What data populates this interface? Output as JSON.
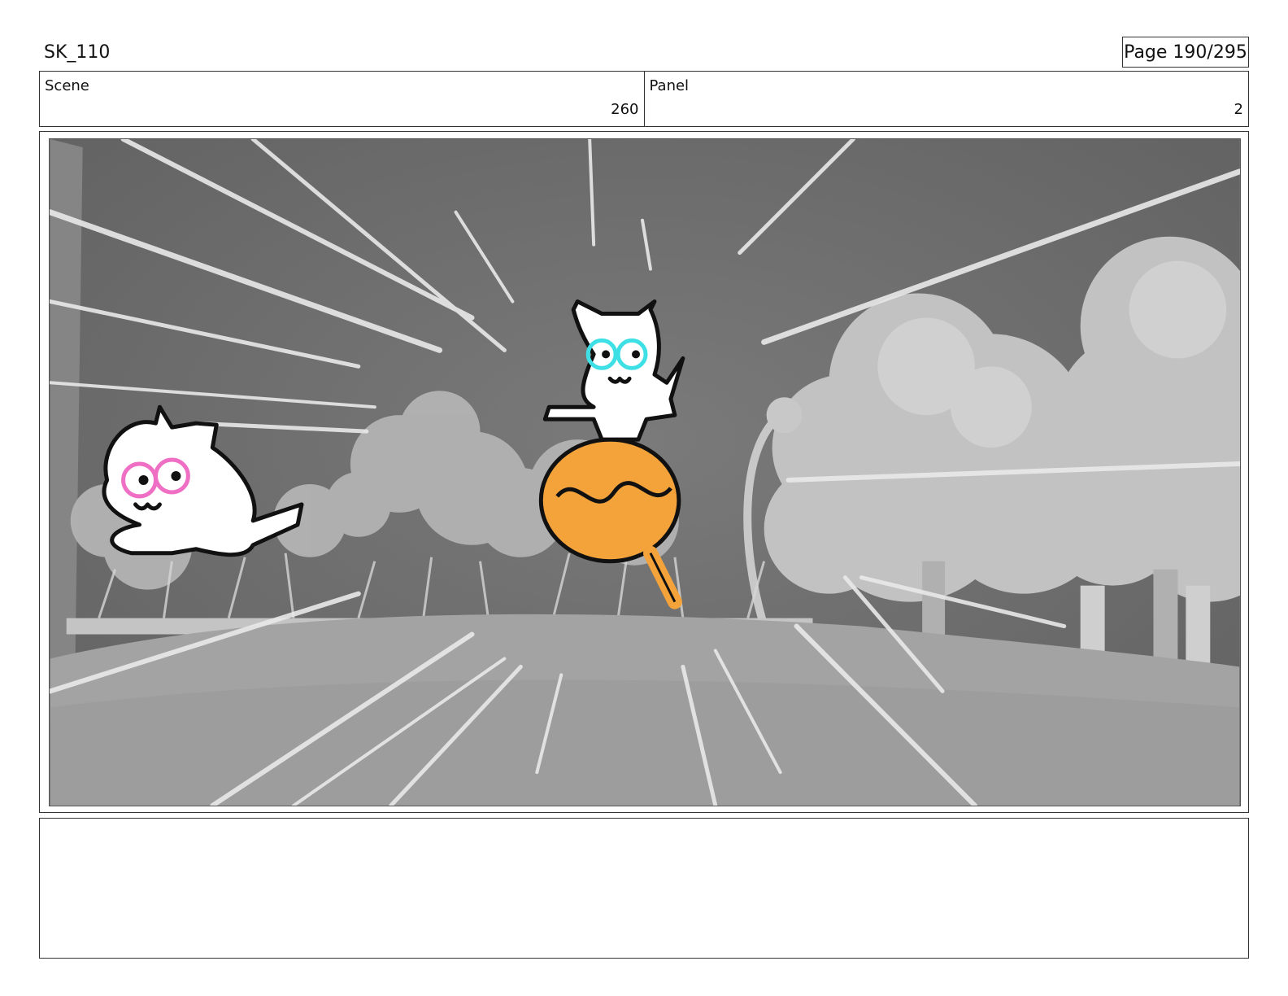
{
  "header": {
    "title": "SK_110",
    "page": "Page 190/295"
  },
  "info": {
    "scene_label": "Scene",
    "scene_value": "260",
    "panel_label": "Panel",
    "panel_value": "2"
  },
  "artwork": {
    "description_icon": "storyboard-panel-image",
    "colors": {
      "background": "#6d6d6d",
      "ground": "#a5a5a5",
      "trees": "#b9b9b9",
      "speed_lines": "#e6e6e6",
      "orange_ball": "#f3a33a",
      "pink_eyes": "#ee6fc4",
      "cyan_eyes": "#3ee0e6"
    }
  },
  "notes": {
    "text": ""
  }
}
